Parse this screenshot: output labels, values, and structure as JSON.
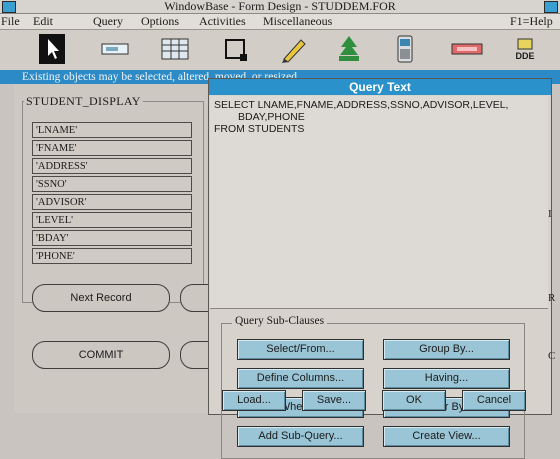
{
  "window": {
    "title": "WindowBase - Form Design - STUDDEM.FOR"
  },
  "menu": {
    "items": [
      "File",
      "Edit",
      "Query",
      "Options",
      "Activities",
      "Miscellaneous"
    ],
    "help": "F1=Help"
  },
  "toolbar": {
    "tools": [
      "pointer-tool",
      "field-tool",
      "grid-tool",
      "box-tool",
      "pen-tool",
      "tree-tool",
      "phone-tool",
      "button-tool",
      "dde-tool"
    ],
    "dde_label": "DDE"
  },
  "status": {
    "message": "Existing objects may be selected, altered, moved, or resized"
  },
  "form": {
    "group_title": "STUDENT_DISPLAY",
    "fields": [
      "'LNAME'",
      "'FNAME'",
      "'ADDRESS'",
      "'SSNO'",
      "'ADVISOR'",
      "'LEVEL'",
      "'BDAY'",
      "'PHONE'"
    ],
    "buttons": [
      "Next Record",
      "COMMIT"
    ]
  },
  "query_dialog": {
    "title": "Query Text",
    "sql_lines": [
      "SELECT LNAME,FNAME,ADDRESS,SSNO,ADVISOR,LEVEL,",
      "BDAY,PHONE",
      "FROM STUDENTS"
    ],
    "subclause_title": "Query Sub-Clauses",
    "subclause_buttons": [
      "Select/From...",
      "Group By...",
      "Define Columns...",
      "Having...",
      "Where...",
      "Order By...",
      "Add Sub-Query...",
      "Create View..."
    ],
    "bottom_buttons": [
      "Load...",
      "Save...",
      "OK",
      "Cancel"
    ]
  },
  "right_edge_glyphs": [
    "I",
    "R",
    "C"
  ],
  "colors": {
    "title_blue": "#2b91cb",
    "button_face": "#9ac5d6",
    "panel": "#d7d2cc"
  }
}
